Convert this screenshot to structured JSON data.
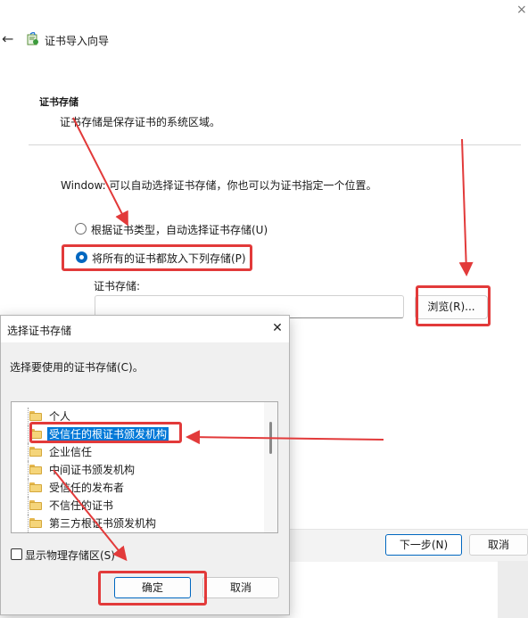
{
  "wizard": {
    "title": "证书导入向导",
    "section_title": "证书存储",
    "section_desc": "证书存储是保存证书的系统区域。",
    "info_text": "Window: 可以自动选择证书存储，你也可以为证书指定一个位置。",
    "radio_auto_label": "根据证书类型，自动选择证书存储(U)",
    "radio_all_label": "将所有的证书都放入下列存储(P)",
    "store_label": "证书存储:",
    "store_value": "",
    "browse_label": "浏览(R)...",
    "next_label": "下一步(N)",
    "cancel_label": "取消",
    "close_glyph": "×",
    "back_glyph": "←"
  },
  "dialog": {
    "title": "选择证书存储",
    "close_glyph": "✕",
    "prompt": "选择要使用的证书存储(C)。",
    "tree_items": [
      "个人",
      "受信任的根证书颁发机构",
      "企业信任",
      "中间证书颁发机构",
      "受信任的发布者",
      "不信任的证书",
      "第三方根证书颁发机构"
    ],
    "selected_index": 1,
    "show_physical_label": "显示物理存储区(S)",
    "show_physical_checked": false,
    "ok_label": "确定",
    "cancel_label": "取消"
  },
  "icons": {
    "back": "arrow-left-icon",
    "wizard": "certificate-icon",
    "folder": "folder-icon"
  },
  "colors": {
    "accent": "#0067c0",
    "selection": "#0078d7",
    "annotation": "#e23a3a"
  }
}
